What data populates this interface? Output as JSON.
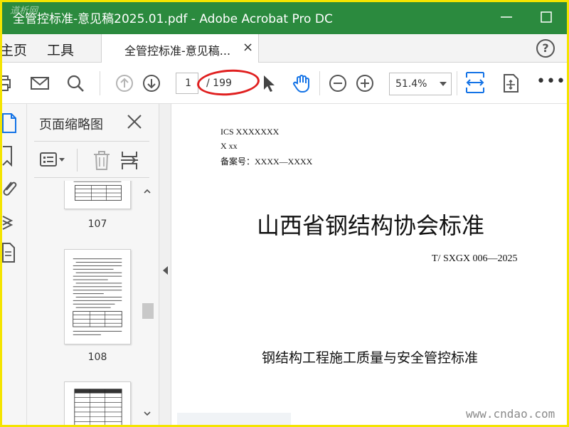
{
  "window": {
    "title": "全管控标准-意见稿2025.01.pdf - Adobe Acrobat Pro DC",
    "watermark_logo": "道析网"
  },
  "menu": {
    "home": "主页",
    "tools": "工具",
    "doc_tab": "全管控标准-意见稿...",
    "doc_tab_close": "×",
    "help": "?"
  },
  "toolbar": {
    "current_page": "1",
    "page_total": "/ 199",
    "zoom": "51.4%",
    "more": "•••"
  },
  "panel": {
    "title": "页面缩略图",
    "thumbnails": [
      {
        "label": "107"
      },
      {
        "label": "108"
      }
    ]
  },
  "document": {
    "ics": "ICS    XXXXXXX",
    "class_code": "X xx",
    "record": "备案号：XXXX—XXXX",
    "title": "山西省钢结构协会标准",
    "code": "T/ SXGX 006—2025",
    "subtitle": "钢结构工程施工质量与安全管控标准"
  },
  "site_watermark": "www.cndao.com",
  "colors": {
    "titlebar": "#2b8a3e",
    "accent_blue": "#1473e6",
    "annotation_red": "#e02020",
    "frame_yellow": "#f4e400"
  }
}
